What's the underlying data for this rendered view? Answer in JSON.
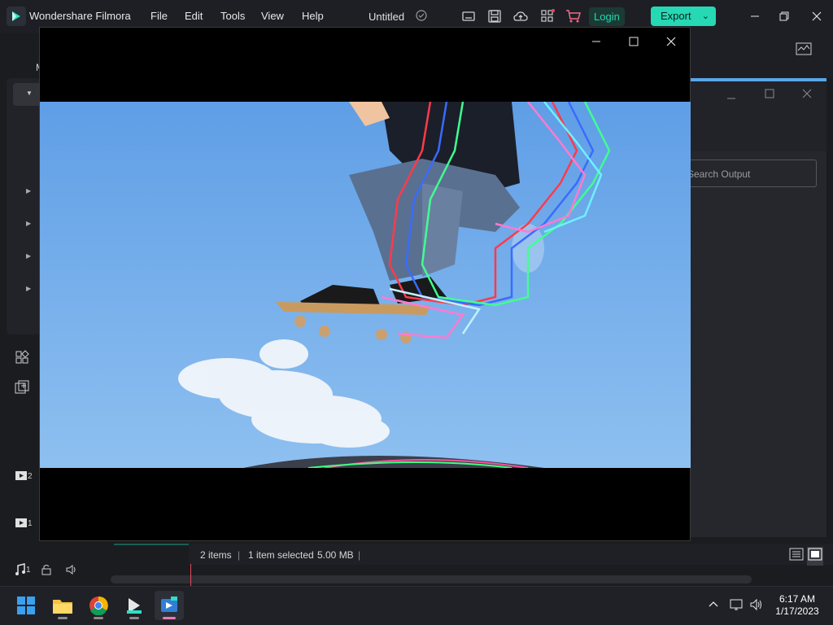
{
  "app": {
    "name": "Wondershare Filmora",
    "doc_title": "Untitled"
  },
  "menu": [
    "File",
    "Edit",
    "Tools",
    "View",
    "Help"
  ],
  "toolbar": {
    "login_label": "Login",
    "export_label": "Export"
  },
  "left_panel": {
    "partial_label": "M"
  },
  "right_panel": {
    "search_placeholder": "Search Output"
  },
  "timeline": {
    "track_2": "2",
    "track_1": "1",
    "audio_track": "1"
  },
  "status": {
    "items": "2 items",
    "selected": "1 item selected",
    "size": "5.00 MB",
    "sep": "|"
  },
  "taskbar": {
    "time": "6:17 AM",
    "date": "1/17/2023",
    "apps": [
      "windows-start",
      "file-explorer",
      "chrome",
      "filmora-installer",
      "filmora"
    ]
  },
  "colors": {
    "accent": "#27d8b5",
    "playhead": "#e44a5a",
    "sky": "#6aa6e8"
  }
}
